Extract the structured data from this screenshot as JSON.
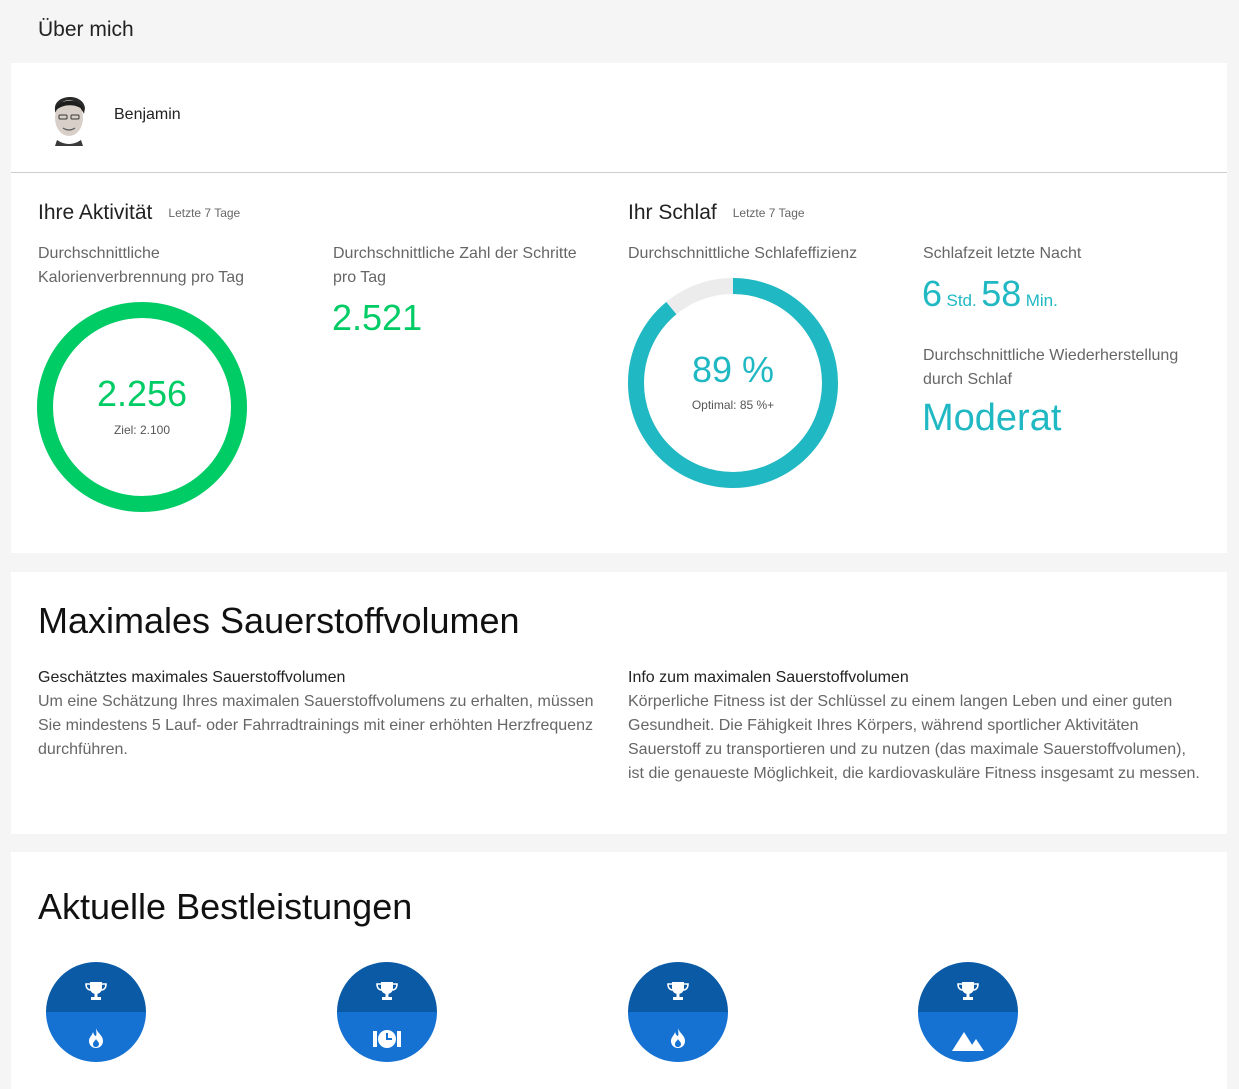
{
  "page_title": "Über mich",
  "profile": {
    "name": "Benjamin"
  },
  "activity": {
    "title": "Ihre Aktivität",
    "period": "Letzte 7 Tage",
    "calories_label": "Durchschnittliche Kalorienverbrennung pro Tag",
    "calories_value": "2.256",
    "calories_goal": "Ziel: 2.100",
    "calories_progress": 1.0,
    "steps_label": "Durchschnittliche Zahl der Schritte pro Tag",
    "steps_value": "2.521"
  },
  "sleep": {
    "title": "Ihr Schlaf",
    "period": "Letzte 7 Tage",
    "efficiency_label": "Durchschnittliche Schlafeffizienz",
    "efficiency_value": "89 %",
    "efficiency_optimal": "Optimal: 85 %+",
    "efficiency_progress": 0.89,
    "last_night_label": "Schlafzeit letzte Nacht",
    "last_night_hours": "6",
    "last_night_hours_unit": "Std.",
    "last_night_minutes": "58",
    "last_night_minutes_unit": "Min.",
    "recovery_label": "Durchschnittliche Wiederherstellung durch Schlaf",
    "recovery_value": "Moderat"
  },
  "vo2": {
    "title": "Maximales Sauerstoffvolumen",
    "estimate_heading": "Geschätztes maximales Sauerstoffvolumen",
    "estimate_text": "Um eine Schätzung Ihres maximalen Sauerstoffvolumens zu erhalten, müssen Sie mindestens 5 Lauf- oder Fahrradtrainings mit einer erhöhten Herzfrequenz durchführen.",
    "info_heading": "Info zum maximalen Sauerstoffvolumen",
    "info_text": "Körperliche Fitness ist der Schlüssel zu einem langen Leben und einer guten Gesundheit. Die Fähigkeit Ihres Körpers, während sportlicher Aktivitäten Sauerstoff zu transportieren und zu nutzen (das maximale Sauerstoffvolumen), ist die genaueste Möglichkeit, die kardiovaskuläre Fitness insgesamt zu messen."
  },
  "records": {
    "title": "Aktuelle Bestleistungen",
    "badges": [
      {
        "top_icon": "trophy-icon",
        "bottom_icon": "flame-icon"
      },
      {
        "top_icon": "trophy-icon",
        "bottom_icon": "stopwatch-icon"
      },
      {
        "top_icon": "trophy-icon",
        "bottom_icon": "flame-icon"
      },
      {
        "top_icon": "trophy-icon",
        "bottom_icon": "mountain-icon"
      }
    ]
  },
  "colors": {
    "activity_green": "#00cc66",
    "sleep_teal": "#1fb8c3",
    "ring_track": "#ececec",
    "badge_dark": "#0a5aa6",
    "badge_light": "#1572d2"
  }
}
